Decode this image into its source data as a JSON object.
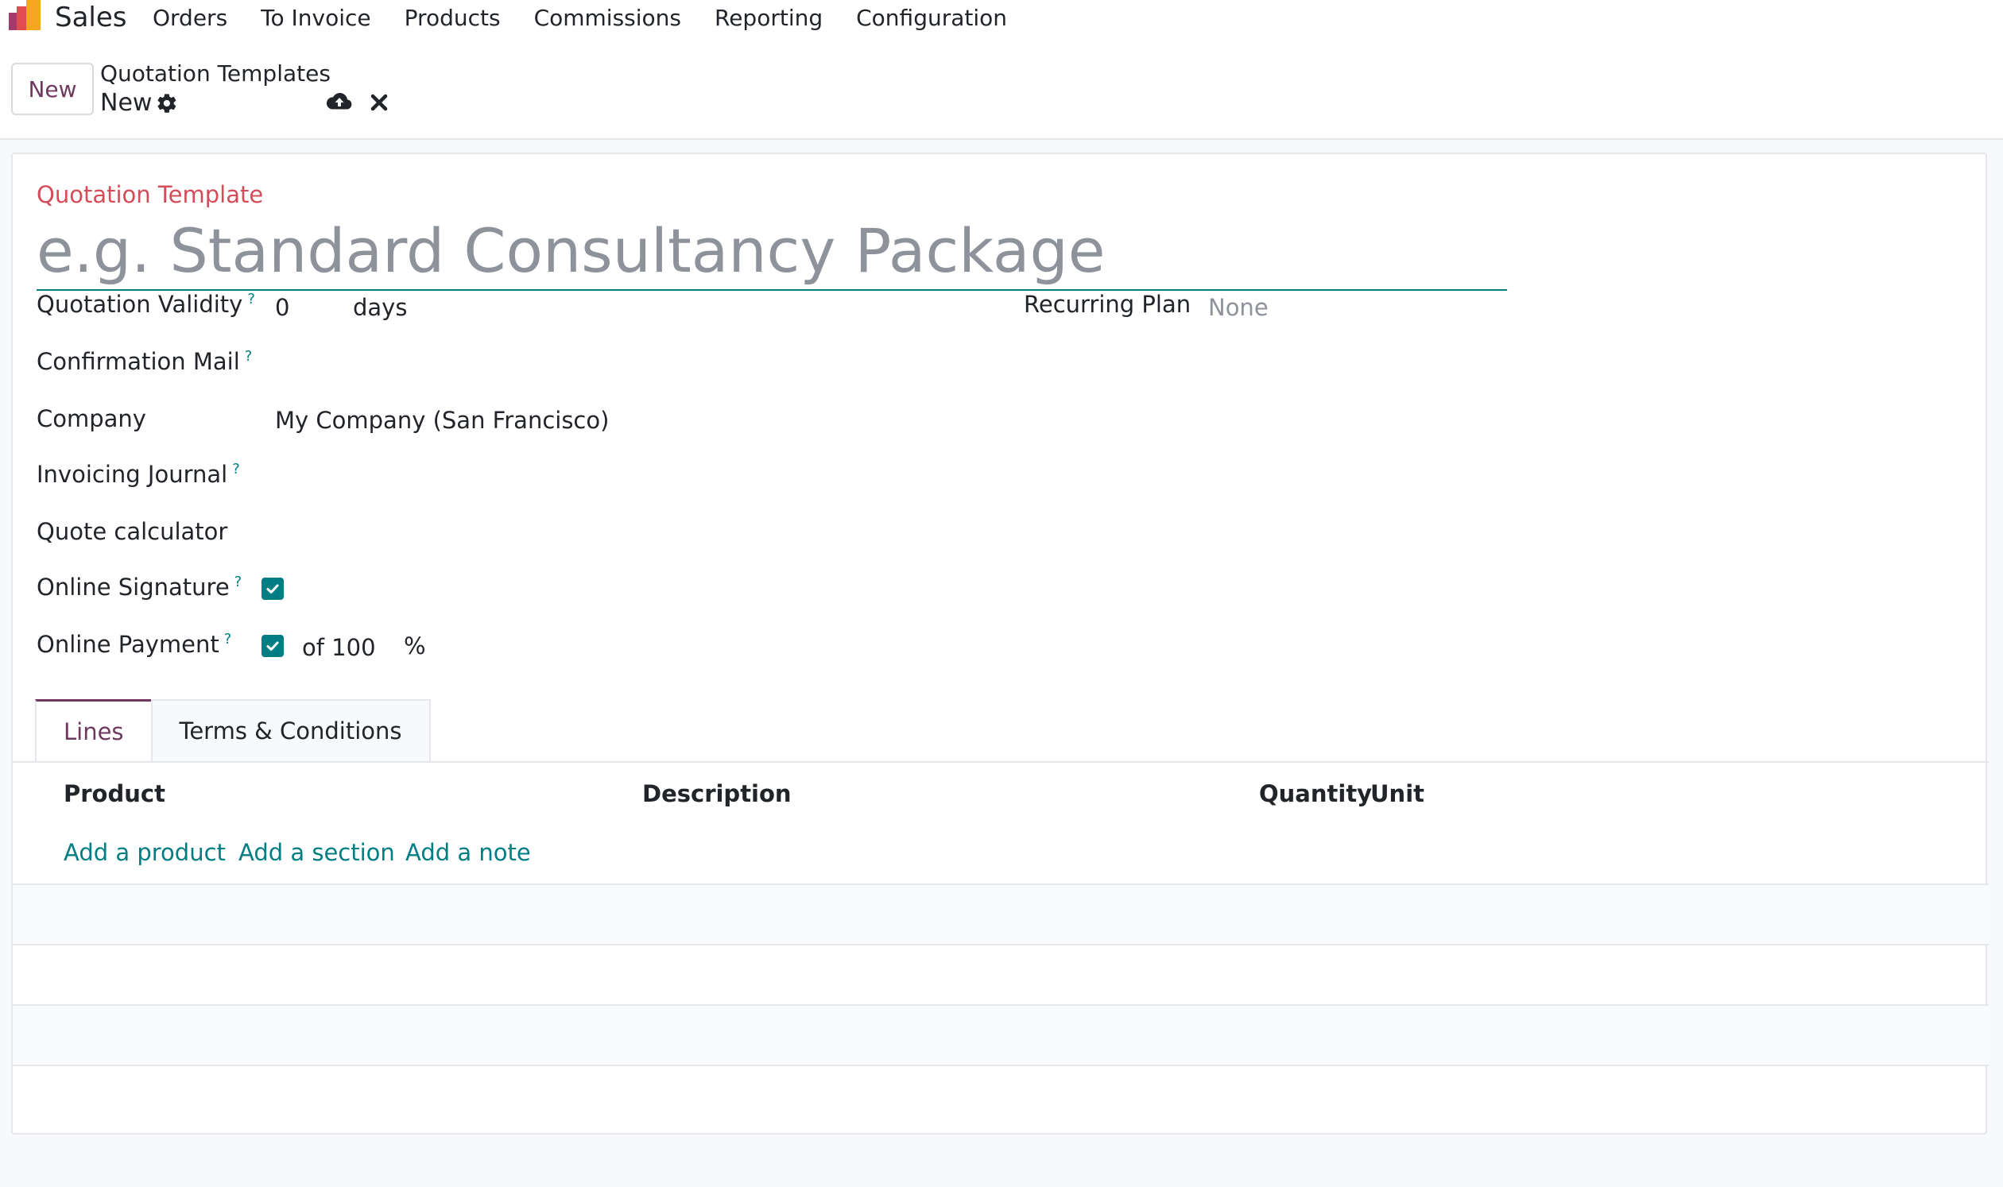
{
  "navbar": {
    "app_name": "Sales",
    "app_icon": "sales-app-logo",
    "menu": [
      "Orders",
      "To Invoice",
      "Products",
      "Commissions",
      "Reporting",
      "Configuration"
    ]
  },
  "control_panel": {
    "new_button": "New",
    "breadcrumb_parent": "Quotation Templates",
    "record_name": "New",
    "icons": [
      "gear-icon",
      "cloud-upload-icon",
      "close-icon"
    ]
  },
  "form": {
    "title_label": "Quotation Template",
    "name_placeholder": "e.g. Standard Consultancy Package",
    "help_mark": "?",
    "fields": {
      "validity": {
        "label": "Quotation Validity",
        "value": "0",
        "unit": "days"
      },
      "recurring_plan": {
        "label": "Recurring Plan",
        "placeholder": "None"
      },
      "confirmation_mail": {
        "label": "Confirmation Mail"
      },
      "company": {
        "label": "Company",
        "value": "My Company (San Francisco)"
      },
      "invoicing_journal": {
        "label": "Invoicing Journal"
      },
      "quote_calculator": {
        "label": "Quote calculator"
      },
      "online_signature": {
        "label": "Online Signature",
        "checked": true
      },
      "online_payment": {
        "label": "Online Payment",
        "checked": true,
        "prefix": "of 100",
        "unit": "%"
      }
    },
    "tabs": [
      {
        "label": "Lines",
        "active": true
      },
      {
        "label": "Terms & Conditions",
        "active": false
      }
    ],
    "lines_table": {
      "columns": [
        "Product",
        "Description",
        "Quantity",
        "Unit"
      ],
      "add_links": [
        "Add a product",
        "Add a section",
        "Add a note"
      ]
    }
  },
  "colors": {
    "accent": "#71385f",
    "link": "#017e84",
    "required_label": "#d44c59",
    "placeholder": "#8e929a"
  }
}
